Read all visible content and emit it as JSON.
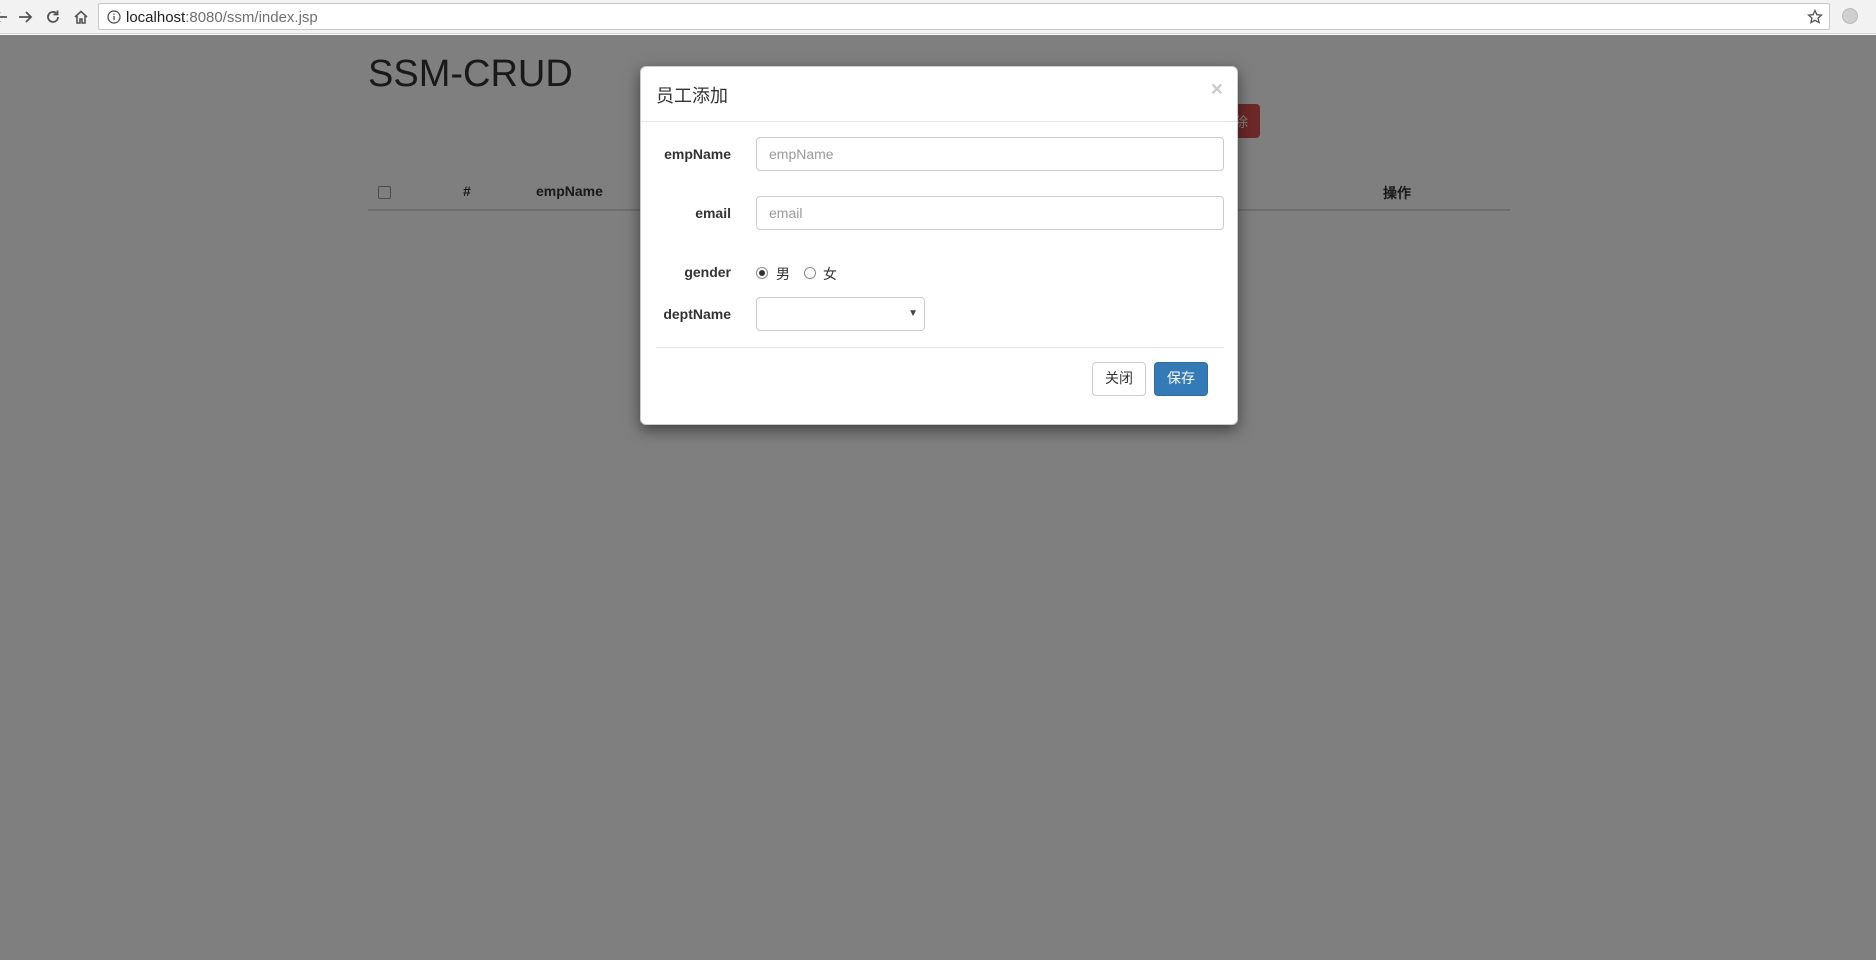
{
  "browser": {
    "url_host": "localhost",
    "url_rest": ":8080/ssm/index.jsp"
  },
  "page": {
    "title": "SSM-CRUD",
    "delete_button": "删除",
    "table_headers": [
      "#",
      "empName",
      "操作"
    ]
  },
  "modal": {
    "title": "员工添加",
    "close_symbol": "×",
    "fields": {
      "empName": {
        "label": "empName",
        "placeholder": "empName",
        "value": ""
      },
      "email": {
        "label": "email",
        "placeholder": "email",
        "value": ""
      },
      "gender": {
        "label": "gender",
        "options": [
          "男",
          "女"
        ],
        "selected": "男"
      },
      "deptName": {
        "label": "deptName",
        "selected": ""
      }
    },
    "buttons": {
      "close": "关闭",
      "save": "保存"
    }
  }
}
